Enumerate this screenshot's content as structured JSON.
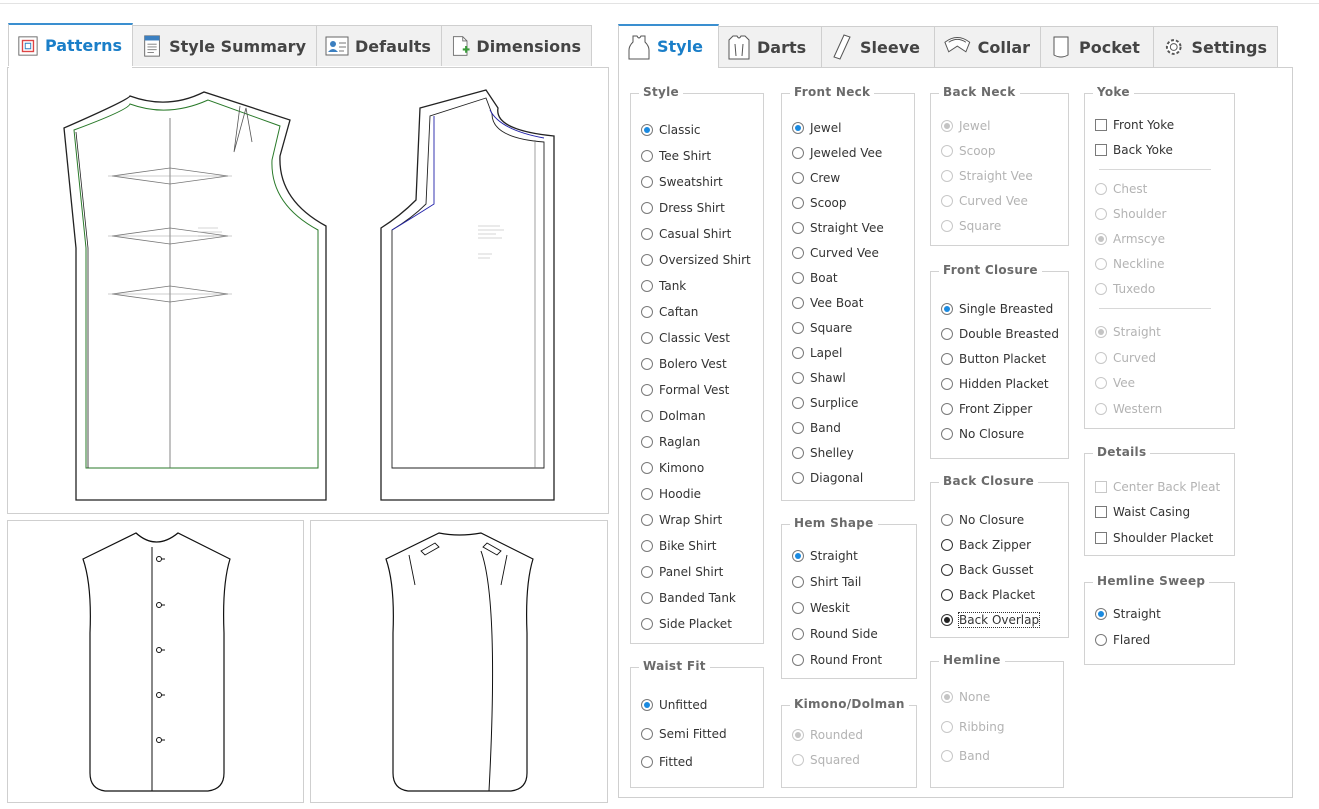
{
  "left_tabs": [
    {
      "label": "Patterns",
      "icon": "patterns-icon",
      "active": true
    },
    {
      "label": "Style Summary",
      "icon": "document-icon",
      "active": false
    },
    {
      "label": "Defaults",
      "icon": "user-card-icon",
      "active": false
    },
    {
      "label": "Dimensions",
      "icon": "add-page-icon",
      "active": false
    }
  ],
  "right_tabs": [
    {
      "label": "Style",
      "icon": "vest-icon",
      "active": true
    },
    {
      "label": "Darts",
      "icon": "darts-icon",
      "active": false
    },
    {
      "label": "Sleeve",
      "icon": "sleeve-icon",
      "active": false
    },
    {
      "label": "Collar",
      "icon": "collar-icon",
      "active": false
    },
    {
      "label": "Pocket",
      "icon": "pocket-icon",
      "active": false
    },
    {
      "label": "Settings",
      "icon": "gear-icon",
      "active": false
    }
  ],
  "groups": {
    "style": {
      "legend": "Style",
      "options": [
        "Classic",
        "Tee Shirt",
        "Sweatshirt",
        "Dress Shirt",
        "Casual Shirt",
        "Oversized Shirt",
        "Tank",
        "Caftan",
        "Classic Vest",
        "Bolero Vest",
        "Formal Vest",
        "Dolman",
        "Raglan",
        "Kimono",
        "Hoodie",
        "Wrap Shirt",
        "Bike Shirt",
        "Panel Shirt",
        "Banded Tank",
        "Side Placket"
      ],
      "selected": 0
    },
    "waist_fit": {
      "legend": "Waist Fit",
      "options": [
        "Unfitted",
        "Semi Fitted",
        "Fitted"
      ],
      "selected": 0
    },
    "front_neck": {
      "legend": "Front Neck",
      "options": [
        "Jewel",
        "Jeweled Vee",
        "Crew",
        "Scoop",
        "Straight Vee",
        "Curved Vee",
        "Boat",
        "Vee Boat",
        "Square",
        "Lapel",
        "Shawl",
        "Surplice",
        "Band",
        "Shelley",
        "Diagonal"
      ],
      "selected": 0
    },
    "hem_shape": {
      "legend": "Hem Shape",
      "options": [
        "Straight",
        "Shirt Tail",
        "Weskit",
        "Round Side",
        "Round Front"
      ],
      "selected": 0
    },
    "kimono_dolman": {
      "legend": "Kimono/Dolman",
      "options": [
        "Rounded",
        "Squared"
      ],
      "selected": 0
    },
    "back_neck": {
      "legend": "Back Neck",
      "options": [
        "Jewel",
        "Scoop",
        "Straight Vee",
        "Curved Vee",
        "Square"
      ],
      "selected": 0
    },
    "front_closure": {
      "legend": "Front Closure",
      "options": [
        "Single Breasted",
        "Double Breasted",
        "Button Placket",
        "Hidden Placket",
        "Front Zipper",
        "No Closure"
      ],
      "selected": 0
    },
    "back_closure": {
      "legend": "Back Closure",
      "options": [
        "No Closure",
        "Back Zipper",
        "Back Gusset",
        "Back Placket",
        "Back Overlap"
      ],
      "selected": 4
    },
    "hemline": {
      "legend": "Hemline",
      "options": [
        "None",
        "Ribbing",
        "Band"
      ],
      "selected": 0
    },
    "yoke": {
      "legend": "Yoke",
      "checks": [
        "Front Yoke",
        "Back Yoke"
      ],
      "placements": [
        "Chest",
        "Shoulder",
        "Armscye",
        "Neckline",
        "Tuxedo"
      ],
      "placement_selected": 2,
      "shapes": [
        "Straight",
        "Curved",
        "Vee",
        "Western"
      ],
      "shape_selected": 0
    },
    "details": {
      "legend": "Details",
      "checks": [
        "Center Back Pleat",
        "Waist Casing",
        "Shoulder Placket"
      ]
    },
    "hemline_sweep": {
      "legend": "Hemline Sweep",
      "options": [
        "Straight",
        "Flared"
      ],
      "selected": 0
    }
  }
}
